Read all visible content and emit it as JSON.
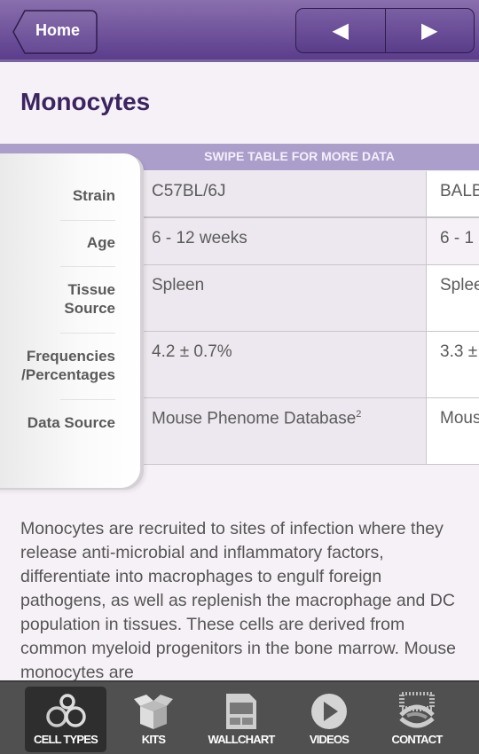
{
  "header": {
    "home_label": "Home",
    "prev_icon": "◀",
    "next_icon": "▶"
  },
  "page": {
    "title": "Monocytes",
    "swipe_hint": "SWIPE TABLE FOR MORE DATA"
  },
  "table": {
    "row_labels": [
      "Strain",
      "Age",
      "Tissue Source",
      "Frequencies /Percentages",
      "Data Source"
    ],
    "columns": [
      {
        "strain": "C57BL/6J",
        "age": "6 - 12 weeks",
        "tissue": "Spleen",
        "frequency": "4.2 ± 0.7%",
        "source": "Mouse Phenome Database",
        "source_sup": "2"
      },
      {
        "strain": "BALB",
        "age": "6 - 1",
        "tissue": "Splee",
        "frequency": "3.3 ±",
        "source": "Mous"
      }
    ]
  },
  "description": "Monocytes are recruited to sites of infection where they release anti-microbial and inflammatory factors, differentiate into macrophages to engulf foreign pathogens, as well as replenish the macrophage and DC population in tissues. These cells are derived from common myeloid progenitors in the bone marrow. Mouse monocytes are",
  "tabbar": {
    "items": [
      {
        "label": "CELL TYPES",
        "icon": "cell-types-icon",
        "active": true
      },
      {
        "label": "KITS",
        "icon": "box-icon"
      },
      {
        "label": "WALLCHART",
        "icon": "wallchart-icon"
      },
      {
        "label": "VIDEOS",
        "icon": "play-icon"
      },
      {
        "label": "CONTACT",
        "icon": "contact-icon"
      }
    ]
  }
}
